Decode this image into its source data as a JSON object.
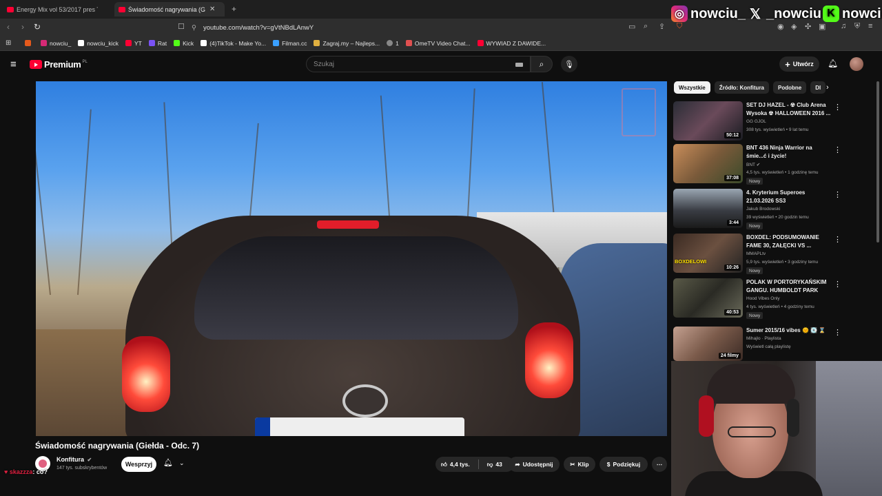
{
  "browser": {
    "tabs": [
      {
        "label": "Energy Mix vol 53/2017 pres The",
        "active": false
      },
      {
        "label": "Świadomość nagrywania (Gie",
        "active": true
      }
    ],
    "new_tab": "+",
    "url": "youtube.com/watch?v=gVtNBdLAnwY",
    "bookmarks": [
      {
        "label": "",
        "color": "#e55a1c"
      },
      {
        "label": "nowciu_",
        "color": "#d62976"
      },
      {
        "label": "nowciu_kick",
        "color": "#ffffff"
      },
      {
        "label": "YT",
        "color": "#ff0033"
      },
      {
        "label": "Rat",
        "color": "#7a52f4"
      },
      {
        "label": "Kick",
        "color": "#53fc18"
      },
      {
        "label": "(4)TikTok - Make Yo...",
        "color": "#ffffff"
      },
      {
        "label": "Filman.cc",
        "color": "#3aa0ff"
      },
      {
        "label": "Zagraj.my – Najleps...",
        "color": "#e0b040"
      },
      {
        "label": "1",
        "color": "#888888"
      },
      {
        "label": "OmeTV Video Chat...",
        "color": "#e05050"
      },
      {
        "label": "WYWIAD Z DAWIDE...",
        "color": "#ff0033"
      }
    ]
  },
  "overlay": {
    "instagram": "nowciu_",
    "x": "_nowciu",
    "kick": "nowciu"
  },
  "header": {
    "logo_word": "Premium",
    "logo_region": "PL",
    "search_placeholder": "Szukaj",
    "create_label": "Utwórz"
  },
  "video": {
    "title": "Świadomość nagrywania (Giełda - Odc. 7)",
    "channel": "Konfitura",
    "subscribers": "147 tys. subskrybentów",
    "support_label": "Wesprzyj",
    "likes": "4,4 tys.",
    "dislikes": "43",
    "share_label": "Udostępnij",
    "clip_label": "Klip",
    "thanks_label": "Podziękuj"
  },
  "chat": {
    "user": "skazzza",
    "message": ": co?"
  },
  "sidebar": {
    "chips": [
      "Wszystkie",
      "Źródło: Konfitura",
      "Podobne",
      "Dl"
    ],
    "recommendations": [
      {
        "title": "SET DJ HAZEL - ☢ Club Arena Wysoka ☢ HALLOWEEN 2016 ...",
        "channel": "GG GJOL",
        "meta": "308 tys. wyświetleń • 9 lat temu",
        "duration": "50:12",
        "new": "",
        "thumb": "#3a3f4a"
      },
      {
        "title": "BNT 436 Ninja Warrior na śmie...ć i życie!",
        "channel": "BNT",
        "meta": "4,5 tys. wyświetleń • 1 godzinę temu",
        "duration": "37:08",
        "new": "Nowy",
        "thumb": "#a8734a"
      },
      {
        "title": "4. Kryterium Superoes 21.03.2026 SS3",
        "channel": "Jakub Brodowski",
        "meta": "39 wyświetleń • 20 godzin temu",
        "duration": "3:44",
        "new": "Nowy",
        "thumb": "#6b7a88"
      },
      {
        "title": "BOXDEL: PODSUMOWANIE FAME 30, ZAŁĘCKI VS ...",
        "channel": "MMAPLtv",
        "meta": "5,9 tys. wyświetleń • 3 godziny temu",
        "duration": "10:26",
        "new": "Nowy",
        "thumb": "#5a4a3a"
      },
      {
        "title": "POLAK W PORTORYKAŃSKIM GANGU. HUMBOLDT PARK",
        "channel": "Hood Vibes Only",
        "meta": "4 tys. wyświetleń • 4 godziny temu",
        "duration": "40:53",
        "new": "Nowy",
        "thumb": "#4a4f3c"
      },
      {
        "title": "Sumer 2015/16 vibes 🌞 💽 ⌛",
        "channel": "Mihajlo · Playlista",
        "meta": "Wyświetl całą playlistę",
        "duration": "24 filmy",
        "new": "",
        "thumb": "#8a6a5a"
      }
    ]
  }
}
